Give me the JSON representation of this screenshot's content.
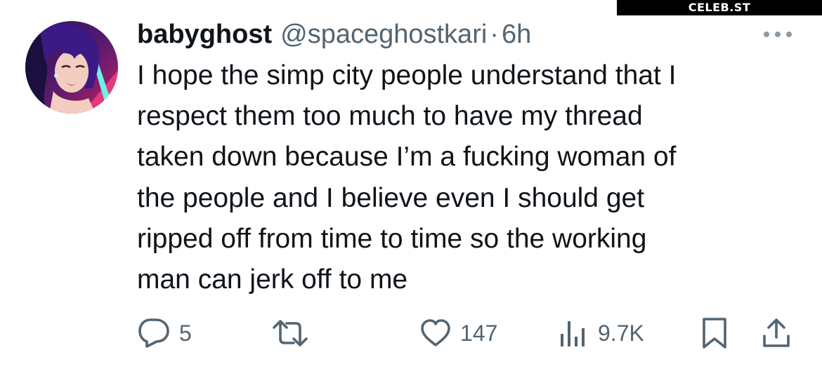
{
  "watermark": "CELEB.ST",
  "tweet": {
    "display_name": "babyghost",
    "handle": "@spaceghostkari",
    "separator": "·",
    "time": "6h",
    "text": "I hope the simp city people understand that I\nrespect them too much to have my thread\ntaken down because I’m a fucking woman of\nthe people and I believe even I should get\nripped off from time to time so the working\nman can jerk off to me"
  },
  "actions": {
    "reply_count": "5",
    "retweet_count": "",
    "like_count": "147",
    "view_count": "9.7K"
  },
  "icons": {
    "avatar": "avatar-image",
    "more": "more-horizontal-icon",
    "reply": "reply-bubble-icon",
    "retweet": "retweet-icon",
    "like": "heart-icon",
    "views": "views-chart-icon",
    "bookmark": "bookmark-icon",
    "share": "share-icon"
  },
  "colors": {
    "text_primary": "#0f1419",
    "text_secondary": "#536471",
    "more_dots": "#8b98a5"
  }
}
